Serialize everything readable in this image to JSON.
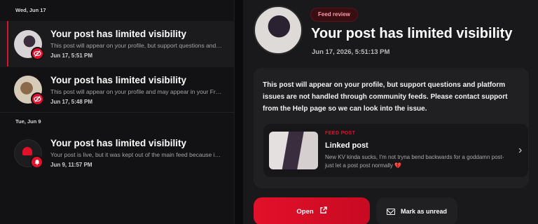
{
  "groups": [
    {
      "label": "Wed, Jun 17",
      "items": [
        {
          "title": "Your post has limited visibility",
          "body": "This post will appear on your profile, but support questions and pla...",
          "time": "Jun 17, 5:51 PM"
        },
        {
          "title": "Your post has limited visibility",
          "body": "This post will appear on your profile and may appear in your Friend...",
          "time": "Jun 17, 5:48 PM"
        }
      ]
    },
    {
      "label": "Tue, Jun 9",
      "items": [
        {
          "title": "Your post has limited visibility",
          "body": "Your post is live, but it was kept out of the main feed because it is ...",
          "time": "Jun 9, 11:57 PM"
        }
      ]
    }
  ],
  "detail": {
    "tag": "Feed review",
    "title": "Your post has limited visibility",
    "timestamp": "Jun 17, 2026, 5:51:13 PM",
    "message": "This post will appear on your profile, but support questions and platform issues are not handled through community feeds. Please contact support from the Help page so we can look into the issue.",
    "linked_post": {
      "kicker": "FEED POST",
      "title": "Linked post",
      "body": "New KV kinda sucks, I'm not tryna bend backwards for a goddamn post- just let a post post normally 💔"
    },
    "open_label": "Open",
    "mark_unread_label": "Mark as unread"
  },
  "colors": {
    "accent": "#e3102a",
    "background": "#0b0b0c",
    "panel": "#19191b"
  },
  "icons": {
    "visibility_badge": "eye-off-icon",
    "bell_badge": "bell-icon",
    "open": "external-link-icon",
    "mail": "mail-icon",
    "chevron": "chevron-right-icon"
  }
}
